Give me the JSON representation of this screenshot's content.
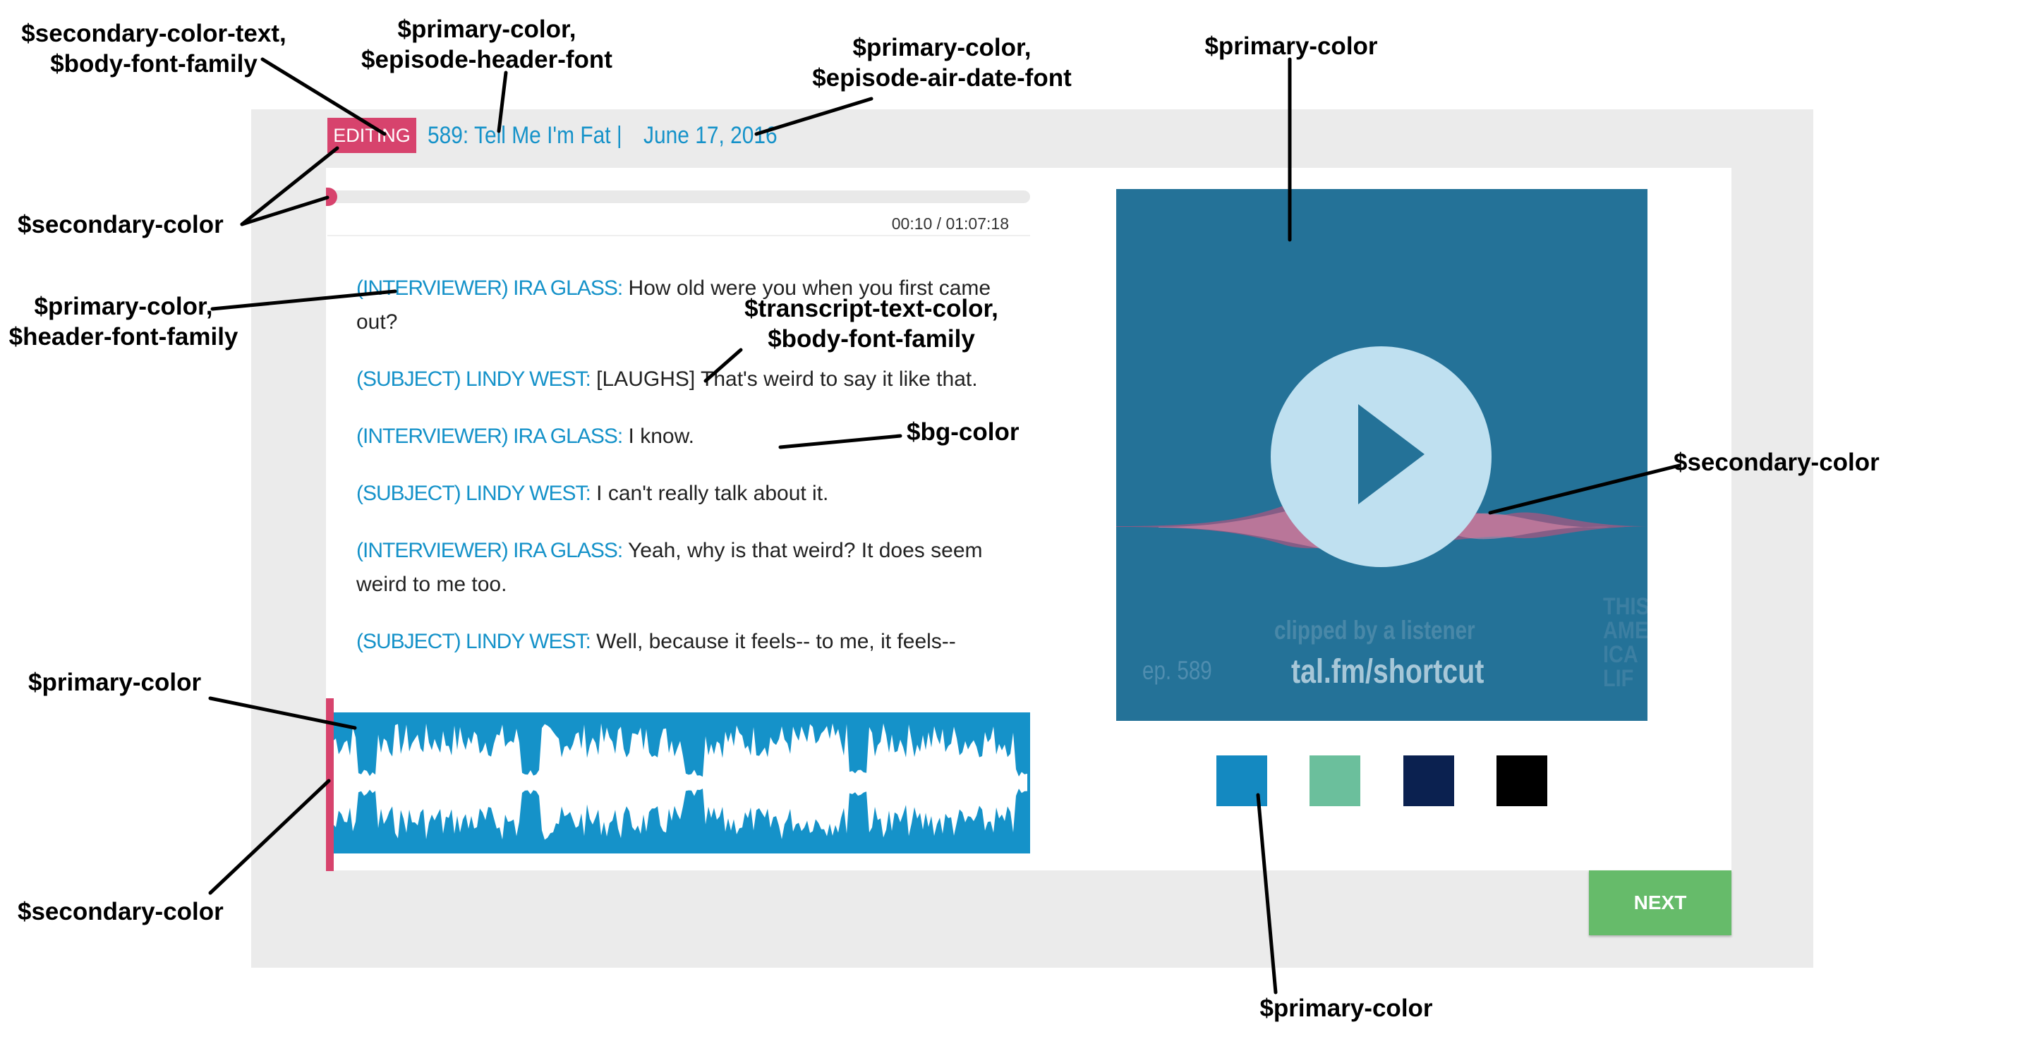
{
  "annotations": {
    "badge_label": [
      "$secondary-color-text,",
      "$body-font-family"
    ],
    "title_label": [
      "$primary-color,",
      "$episode-header-font"
    ],
    "date_label": [
      "$primary-color,",
      "$episode-air-date-font"
    ],
    "preview_label": [
      "$primary-color"
    ],
    "progress_label": [
      "$secondary-color"
    ],
    "speaker_label": [
      "$primary-color,",
      "$header-font-family"
    ],
    "transcript_text_label": [
      "$transcript-text-color,",
      "$body-font-family"
    ],
    "bg_label": [
      "$bg-color"
    ],
    "wave_accent_label": [
      "$secondary-color"
    ],
    "waveform_label": [
      "$primary-color"
    ],
    "cursor_label": [
      "$secondary-color"
    ],
    "swatch_label": [
      "$primary-color"
    ]
  },
  "header": {
    "badge": "EDITING",
    "episode_title": "589: Tell Me I'm Fat |",
    "episode_date": "June 17, 2016"
  },
  "player": {
    "time": "00:10 / 01:07:18",
    "progress_fraction": 0.01
  },
  "transcript": [
    {
      "speaker": "(INTERVIEWER) IRA GLASS:",
      "text": " How old were you when you first came out?"
    },
    {
      "speaker": "(SUBJECT) LINDY WEST:",
      "text": " [LAUGHS] That's weird to say it like that."
    },
    {
      "speaker": "(INTERVIEWER) IRA GLASS:",
      "text": " I know."
    },
    {
      "speaker": "(SUBJECT) LINDY WEST:",
      "text": " I can't really talk about it."
    },
    {
      "speaker": "(INTERVIEWER) IRA GLASS:",
      "text": " Yeah, why is that weird? It does seem weird to me too."
    },
    {
      "speaker": "(SUBJECT) LINDY WEST:",
      "text": " Well, because it feels-- to me, it feels--"
    }
  ],
  "preview": {
    "clipped_text": "clipped by a listener",
    "episode_text": "ep. 589",
    "url_text": "tal.fm/shortcut",
    "logo_text": "THIS\nAME\nICA\nLIF"
  },
  "swatches": [
    "#1489c1",
    "#6bbf9c",
    "#0b2150",
    "#000000"
  ],
  "colors": {
    "primary": "#1592c9",
    "secondary": "#d7436d",
    "preview_bg": "#247298",
    "next_button": "#66bb6a",
    "frame_bg": "#ebebeb"
  },
  "next_button": "NEXT"
}
